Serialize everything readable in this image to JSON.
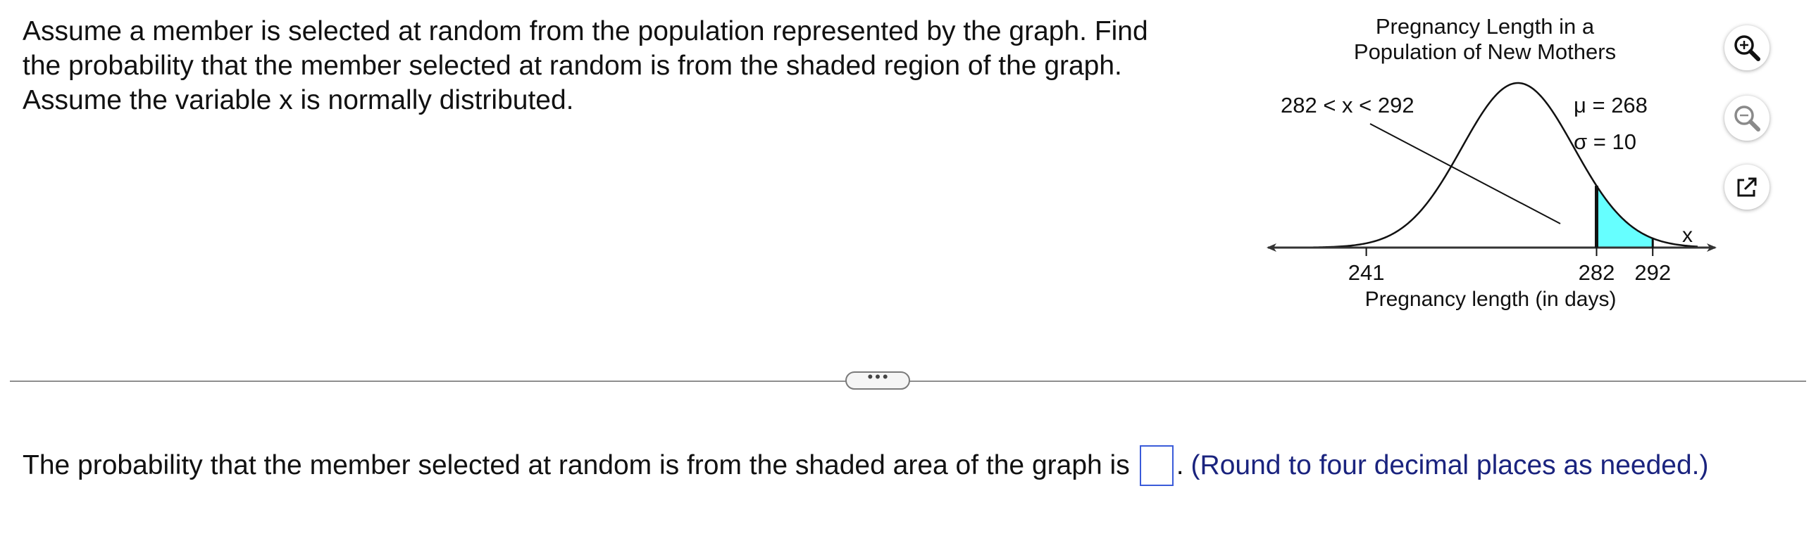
{
  "question": {
    "line1": "Assume a member is selected at random from the population represented by the graph. Find",
    "line2": "the probability that the member selected at random is from the shaded region of the graph.",
    "line3": "Assume the variable x is normally distributed."
  },
  "figure": {
    "title_line1": "Pregnancy Length in a",
    "title_line2": "Population of New Mothers",
    "range_label": "282 < x < 292",
    "mu_label": "μ = 268",
    "sigma_label": "σ = 10",
    "axis_variable": "x",
    "tick_241": "241",
    "tick_282": "282",
    "tick_292": "292",
    "xlabel": "Pregnancy length (in days)",
    "mean": 268,
    "sd": 10,
    "shade_from": 282,
    "shade_to": 292,
    "shade_color": "#66ffff"
  },
  "tools": {
    "zoom_in": "zoom-in-icon",
    "zoom_out": "zoom-out-icon",
    "popout": "popout-icon"
  },
  "answer": {
    "prefix": "The probability that the member selected at random is from the shaded area of the graph is",
    "value": "",
    "suffix": ".",
    "hint": "(Round to four decimal places as needed.)"
  },
  "colors": {
    "hint": "#1a237e",
    "input_border": "#3a5bd9"
  }
}
